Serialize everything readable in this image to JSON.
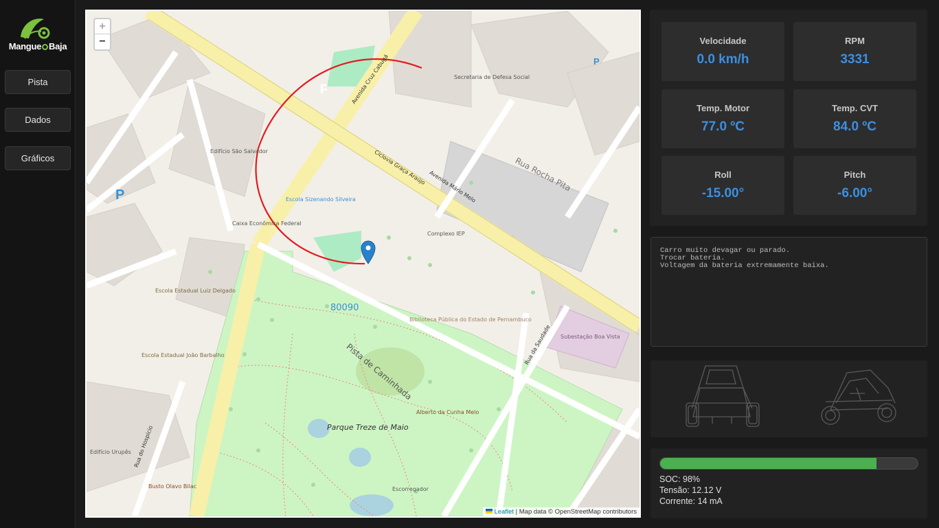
{
  "sidebar": {
    "logo_text_left": "Mangue",
    "logo_text_right": "Baja",
    "nav": [
      {
        "label": "Pista"
      },
      {
        "label": "Dados"
      },
      {
        "label": "Gráficos"
      }
    ]
  },
  "map": {
    "zoom_in": "+",
    "zoom_out": "−",
    "attribution_leaflet": "Leaflet",
    "attribution_rest": " | Map data © OpenStreetMap contributors",
    "labels": {
      "avenida_mario_melo": "Avenida Mário Melo",
      "ciclovia": "Ciclovia Graça Araújo",
      "av_cruz_cabuga": "Avenida Cruz Cabugá",
      "complexo_iep": "Complexo IEP",
      "parque": "Parque Treze de Maio",
      "pista_caminhada": "Pista de Caminhada",
      "rua_rocha_pita": "Rua Rocha Pita",
      "caixa": "Caixa Econômica Federal",
      "sao_salvador": "Edifício São Salvador",
      "escola_sizenando": "Escola Sizenando Silveira",
      "biblioteca": "Biblioteca Pública do Estado de Pernambuco",
      "secretaria": "Secretaria de Defesa Social",
      "subestacao": "Subestação Boa Vista",
      "escola_luiz": "Escola Estadual Luiz Delgado",
      "escola_joao": "Escola Estadual João Barbalho",
      "stop_80090": "80090",
      "rua_hospicio": "Rua do Hospício",
      "escorregador": "Escorregador",
      "alberto": "Alberto da Cunha Melo",
      "busto": "Busto Olavo Bilac",
      "rua_saudade": "Rua da Saudade",
      "edificio_urupes": "Edifício Urupês"
    }
  },
  "metrics": [
    {
      "label": "Velocidade",
      "value": "0.0 km/h"
    },
    {
      "label": "RPM",
      "value": "3331"
    },
    {
      "label": "Temp. Motor",
      "value": "77.0 ºC"
    },
    {
      "label": "Temp. CVT",
      "value": "84.0 ºC"
    },
    {
      "label": "Roll",
      "value": "-15.00°"
    },
    {
      "label": "Pitch",
      "value": "-6.00°"
    }
  ],
  "alerts": [
    "Carro muito devagar ou parado.",
    "Trocar bateria.",
    "Voltagem da bateria extremamente baixa."
  ],
  "battery": {
    "soc_fraction": 0.84,
    "soc": "SOC: 98%",
    "voltage": "Tensão: 12.12 V",
    "current": "Corrente: 14 mA"
  },
  "colors": {
    "accent_blue": "#3d8fe0",
    "battery_green": "#4caf50",
    "track_red": "#e31a1c",
    "marker_blue": "#2a81cb"
  }
}
